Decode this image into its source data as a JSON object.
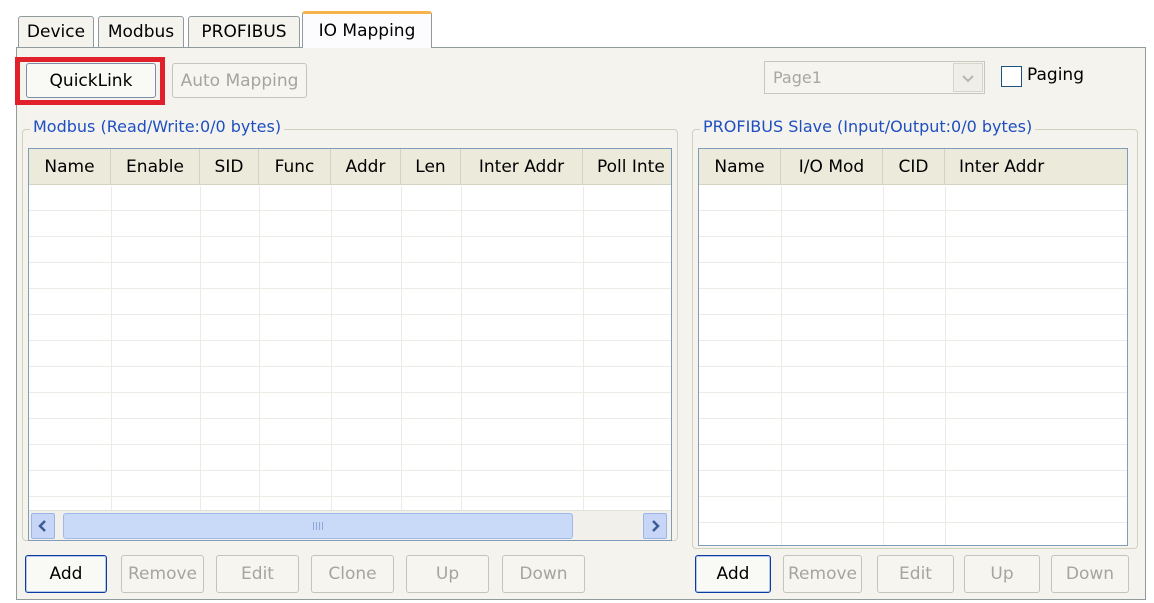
{
  "tabs": [
    {
      "label": "Device"
    },
    {
      "label": "Modbus"
    },
    {
      "label": "PROFIBUS"
    },
    {
      "label": "IO Mapping"
    }
  ],
  "toolbar": {
    "quicklink_label": "QuickLink",
    "auto_mapping_label": "Auto Mapping",
    "page_select_value": "Page1",
    "paging_label": "Paging",
    "paging_checked": false
  },
  "modbus_group": {
    "title": "Modbus (Read/Write:0/0 bytes)",
    "columns": [
      "Name",
      "Enable",
      "SID",
      "Func",
      "Addr",
      "Len",
      "Inter Addr",
      "Poll Inte"
    ],
    "rows": [],
    "buttons": {
      "add": "Add",
      "remove": "Remove",
      "edit": "Edit",
      "clone": "Clone",
      "up": "Up",
      "down": "Down"
    }
  },
  "profibus_group": {
    "title": "PROFIBUS Slave (Input/Output:0/0 bytes)",
    "columns": [
      "Name",
      "I/O Mod",
      "CID",
      "Inter Addr"
    ],
    "rows": [],
    "buttons": {
      "add": "Add",
      "remove": "Remove",
      "edit": "Edit",
      "up": "Up",
      "down": "Down"
    }
  },
  "colors": {
    "highlight": "#e0202a",
    "group_title": "#1f4fc0",
    "active_tab_accent": "#f7b34a"
  },
  "icons": {
    "scroll_left": "scroll-left-icon",
    "scroll_right": "scroll-right-icon",
    "dropdown": "chevron-down-icon"
  }
}
